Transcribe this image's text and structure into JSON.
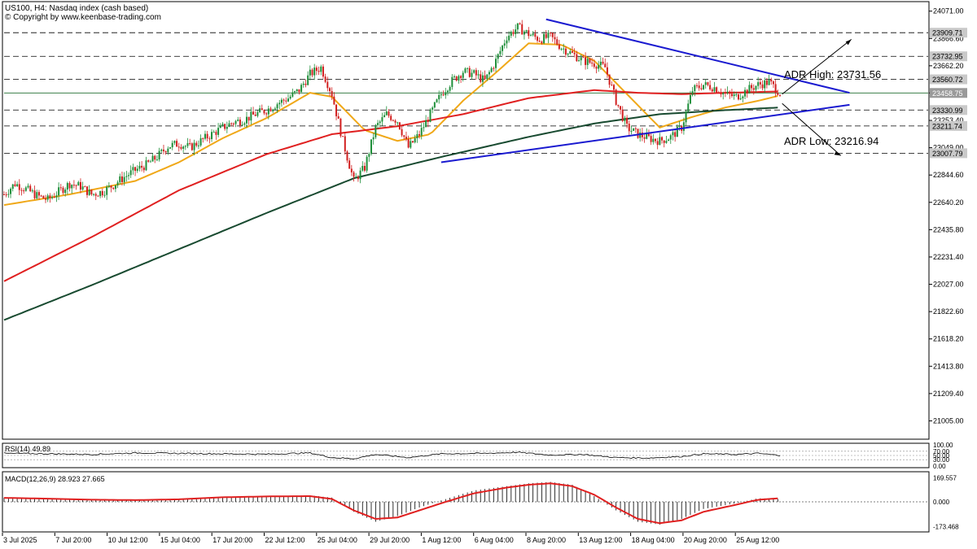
{
  "header": {
    "symbol_line": "US100, H4:  Nasdaq index (cash based)",
    "copyright": "© Copyright by www.keenbase-trading.com"
  },
  "annotations": {
    "adr_high": "ADR High: 23731.56",
    "adr_low": "ADR Low: 23216.94"
  },
  "indicators": {
    "rsi_label": "RSI(14) 49.89",
    "macd_label": "MACD(12,26,9) 28.923 27.665"
  },
  "colors": {
    "bull": "#1f8f3a",
    "bear": "#d11f1f",
    "ma_fast": "#f0a818",
    "ma_mid": "#e02020",
    "ma_slow": "#184a30",
    "trendline": "#1a1ad0",
    "price_tag_bg": "#c9c9c9",
    "last_price_tag": "#9a9a9a",
    "macd_signal": "#e02020",
    "histogram": "#000000",
    "text": "#000000"
  },
  "chart_data": {
    "type": "candlestick",
    "title": "US100, H4:  Nasdaq index (cash based)",
    "price_axis_ticks": [
      "24071.00",
      "23866.60",
      "23662.20",
      "23458.75",
      "23253.40",
      "23049.00",
      "22844.60",
      "22640.20",
      "22435.80",
      "22231.40",
      "22027.00",
      "21822.60",
      "21618.20",
      "21413.80",
      "21209.40",
      "21005.00"
    ],
    "price_range": [
      20880,
      24130
    ],
    "time_axis_labels": [
      "3 Jul 2025",
      "7 Jul 20:00",
      "10 Jul 12:00",
      "15 Jul 04:00",
      "17 Jul 20:00",
      "22 Jul 12:00",
      "25 Jul 04:00",
      "29 Jul 20:00",
      "1 Aug 12:00",
      "6 Aug 04:00",
      "8 Aug 20:00",
      "13 Aug 12:00",
      "18 Aug 04:00",
      "20 Aug 20:00",
      "25 Aug 12:00"
    ],
    "horizontal_levels": [
      {
        "value": 23909.71,
        "label": "23909.71",
        "style": "dashed"
      },
      {
        "value": 23732.95,
        "label": "23732.95",
        "style": "dashed"
      },
      {
        "value": 23560.72,
        "label": "23560.72",
        "style": "dashed"
      },
      {
        "value": 23458.75,
        "label": "23458.75",
        "style": "solid-last-price"
      },
      {
        "value": 23330.99,
        "label": "23330.99",
        "style": "dashed"
      },
      {
        "value": 23211.74,
        "label": "23211.74",
        "style": "dashed"
      },
      {
        "value": 23007.79,
        "label": "23007.79",
        "style": "dashed"
      }
    ],
    "trendlines": [
      {
        "name": "upper",
        "from": [
          "8 Aug 20:00",
          24010
        ],
        "to": [
          "25 Aug 12:00",
          23460
        ]
      },
      {
        "name": "lower",
        "from": [
          "1 Aug 12:00",
          22940
        ],
        "to": [
          "25 Aug 12:00",
          23370
        ]
      }
    ],
    "close_path": [
      [
        0,
        22700
      ],
      [
        5,
        22780
      ],
      [
        10,
        22740
      ],
      [
        15,
        22690
      ],
      [
        20,
        22660
      ],
      [
        25,
        22720
      ],
      [
        30,
        22780
      ],
      [
        35,
        22760
      ],
      [
        40,
        22700
      ],
      [
        45,
        22720
      ],
      [
        50,
        22770
      ],
      [
        55,
        22830
      ],
      [
        60,
        22880
      ],
      [
        65,
        22920
      ],
      [
        70,
        22980
      ],
      [
        75,
        23060
      ],
      [
        80,
        23080
      ],
      [
        85,
        23050
      ],
      [
        90,
        23100
      ],
      [
        95,
        23150
      ],
      [
        100,
        23200
      ],
      [
        105,
        23240
      ],
      [
        110,
        23260
      ],
      [
        115,
        23300
      ],
      [
        120,
        23330
      ],
      [
        125,
        23380
      ],
      [
        130,
        23420
      ],
      [
        135,
        23480
      ],
      [
        140,
        23600
      ],
      [
        145,
        23650
      ],
      [
        150,
        23450
      ],
      [
        155,
        23100
      ],
      [
        160,
        22800
      ],
      [
        165,
        22900
      ],
      [
        170,
        23200
      ],
      [
        175,
        23300
      ],
      [
        180,
        23250
      ],
      [
        185,
        23050
      ],
      [
        190,
        23150
      ],
      [
        195,
        23300
      ],
      [
        200,
        23450
      ],
      [
        205,
        23550
      ],
      [
        210,
        23620
      ],
      [
        215,
        23600
      ],
      [
        220,
        23550
      ],
      [
        225,
        23700
      ],
      [
        230,
        23880
      ],
      [
        235,
        23950
      ],
      [
        240,
        23900
      ],
      [
        245,
        23860
      ],
      [
        250,
        23880
      ],
      [
        255,
        23800
      ],
      [
        260,
        23750
      ],
      [
        265,
        23700
      ],
      [
        270,
        23680
      ],
      [
        275,
        23650
      ],
      [
        280,
        23400
      ],
      [
        285,
        23200
      ],
      [
        290,
        23150
      ],
      [
        295,
        23120
      ],
      [
        300,
        23100
      ],
      [
        305,
        23130
      ],
      [
        310,
        23200
      ],
      [
        315,
        23480
      ],
      [
        320,
        23520
      ],
      [
        325,
        23500
      ],
      [
        330,
        23450
      ],
      [
        335,
        23430
      ],
      [
        340,
        23480
      ],
      [
        345,
        23520
      ],
      [
        350,
        23540
      ],
      [
        355,
        23460
      ]
    ],
    "moving_averages": [
      {
        "name": "MA fast",
        "color": "#f0a818",
        "path": [
          [
            0,
            22620
          ],
          [
            30,
            22700
          ],
          [
            60,
            22800
          ],
          [
            80,
            22940
          ],
          [
            100,
            23120
          ],
          [
            120,
            23270
          ],
          [
            140,
            23460
          ],
          [
            150,
            23430
          ],
          [
            165,
            23180
          ],
          [
            180,
            23100
          ],
          [
            195,
            23150
          ],
          [
            210,
            23400
          ],
          [
            225,
            23610
          ],
          [
            240,
            23830
          ],
          [
            255,
            23820
          ],
          [
            270,
            23700
          ],
          [
            285,
            23450
          ],
          [
            300,
            23200
          ],
          [
            315,
            23280
          ],
          [
            330,
            23350
          ],
          [
            345,
            23400
          ],
          [
            355,
            23440
          ]
        ]
      },
      {
        "name": "MA mid",
        "color": "#e02020",
        "path": [
          [
            0,
            22050
          ],
          [
            40,
            22380
          ],
          [
            80,
            22730
          ],
          [
            120,
            23000
          ],
          [
            150,
            23150
          ],
          [
            180,
            23210
          ],
          [
            210,
            23300
          ],
          [
            240,
            23420
          ],
          [
            270,
            23480
          ],
          [
            290,
            23460
          ],
          [
            310,
            23450
          ],
          [
            330,
            23460
          ],
          [
            355,
            23470
          ]
        ]
      },
      {
        "name": "MA slow",
        "color": "#184a30",
        "path": [
          [
            0,
            21760
          ],
          [
            40,
            22020
          ],
          [
            80,
            22290
          ],
          [
            120,
            22560
          ],
          [
            160,
            22820
          ],
          [
            200,
            22980
          ],
          [
            240,
            23130
          ],
          [
            270,
            23230
          ],
          [
            300,
            23300
          ],
          [
            330,
            23330
          ],
          [
            355,
            23350
          ]
        ]
      }
    ],
    "rsi": {
      "range": [
        0,
        100
      ],
      "levels": [
        100,
        70,
        50,
        30,
        0
      ],
      "tick_labels": [
        "100.00",
        "70.00",
        "50.00",
        "30.00",
        "0.00"
      ],
      "path": [
        [
          0,
          60
        ],
        [
          20,
          58
        ],
        [
          40,
          55
        ],
        [
          60,
          62
        ],
        [
          80,
          60
        ],
        [
          100,
          58
        ],
        [
          120,
          56
        ],
        [
          140,
          62
        ],
        [
          150,
          40
        ],
        [
          160,
          35
        ],
        [
          170,
          55
        ],
        [
          185,
          40
        ],
        [
          200,
          58
        ],
        [
          220,
          60
        ],
        [
          235,
          65
        ],
        [
          250,
          52
        ],
        [
          265,
          55
        ],
        [
          280,
          40
        ],
        [
          295,
          38
        ],
        [
          310,
          45
        ],
        [
          320,
          58
        ],
        [
          335,
          55
        ],
        [
          345,
          60
        ],
        [
          355,
          50
        ]
      ]
    },
    "macd": {
      "range": [
        -200,
        200
      ],
      "tick_labels": [
        "169.557",
        "0.000",
        "-173.468"
      ],
      "histogram": [
        [
          0,
          30
        ],
        [
          20,
          25
        ],
        [
          40,
          15
        ],
        [
          60,
          10
        ],
        [
          80,
          15
        ],
        [
          100,
          35
        ],
        [
          120,
          40
        ],
        [
          140,
          45
        ],
        [
          150,
          30
        ],
        [
          160,
          -70
        ],
        [
          170,
          -140
        ],
        [
          180,
          -100
        ],
        [
          190,
          -40
        ],
        [
          200,
          10
        ],
        [
          215,
          80
        ],
        [
          230,
          110
        ],
        [
          240,
          130
        ],
        [
          250,
          140
        ],
        [
          260,
          120
        ],
        [
          270,
          40
        ],
        [
          280,
          -60
        ],
        [
          290,
          -140
        ],
        [
          300,
          -160
        ],
        [
          310,
          -120
        ],
        [
          320,
          -50
        ],
        [
          335,
          -10
        ],
        [
          345,
          25
        ],
        [
          355,
          20
        ]
      ],
      "signal": [
        [
          0,
          28
        ],
        [
          20,
          22
        ],
        [
          40,
          15
        ],
        [
          60,
          12
        ],
        [
          80,
          18
        ],
        [
          100,
          32
        ],
        [
          120,
          38
        ],
        [
          140,
          40
        ],
        [
          150,
          20
        ],
        [
          160,
          -60
        ],
        [
          170,
          -120
        ],
        [
          180,
          -110
        ],
        [
          190,
          -60
        ],
        [
          200,
          -10
        ],
        [
          215,
          60
        ],
        [
          230,
          100
        ],
        [
          240,
          120
        ],
        [
          250,
          130
        ],
        [
          260,
          110
        ],
        [
          270,
          50
        ],
        [
          280,
          -40
        ],
        [
          290,
          -120
        ],
        [
          300,
          -150
        ],
        [
          310,
          -130
        ],
        [
          320,
          -70
        ],
        [
          335,
          -20
        ],
        [
          345,
          15
        ],
        [
          355,
          25
        ]
      ]
    }
  }
}
